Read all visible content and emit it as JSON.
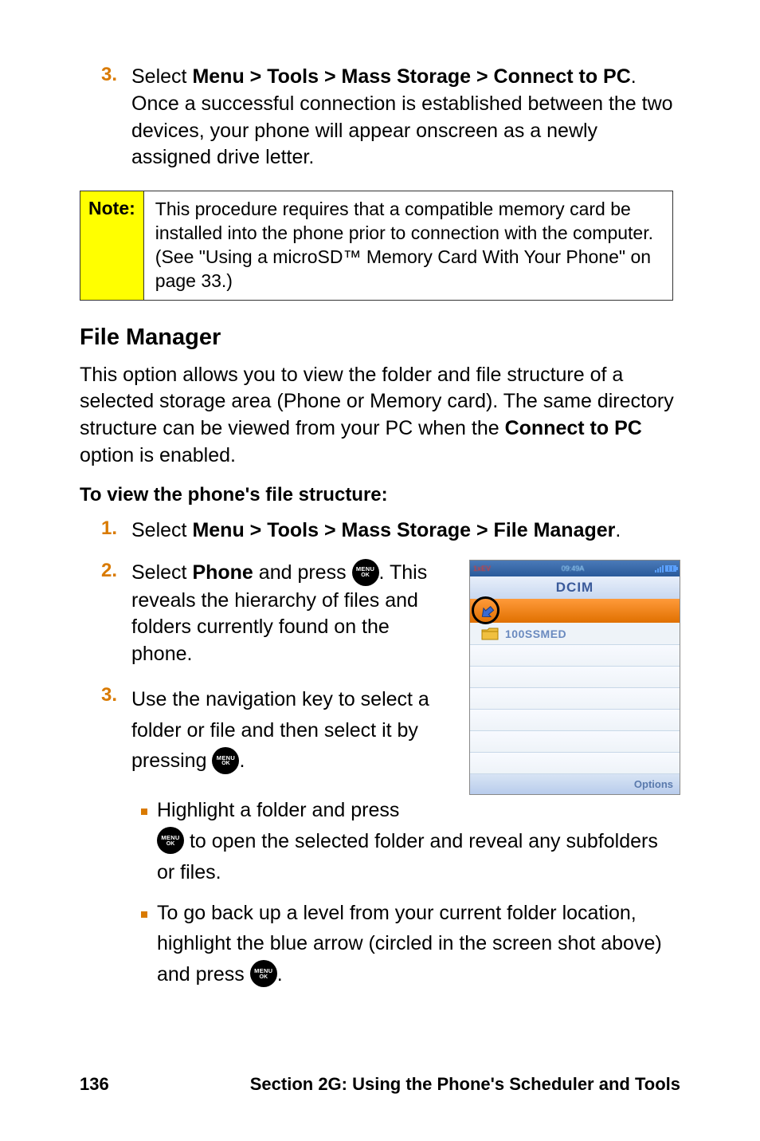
{
  "step3top": {
    "num": "3.",
    "lead": "Select ",
    "path": "Menu > Tools > Mass Storage > Connect to PC",
    "tail": ". Once a successful connection is established between the two devices, your phone will appear onscreen as a newly assigned drive letter."
  },
  "note": {
    "label": "Note:",
    "text": "This procedure requires that a compatible memory card be installed into the phone prior to connection with the computer. (See \"Using a microSD™ Memory Card With Your Phone\" on page 33.)"
  },
  "h2": "File Manager",
  "para": {
    "pre": "This option allows you to view the folder and file structure of a selected storage area (Phone or Memory card). The same directory structure can be viewed from your PC when the ",
    "bold": "Connect to PC",
    "post": " option is enabled."
  },
  "subhead": "To view the phone's file structure:",
  "step1": {
    "num": "1.",
    "lead": "Select ",
    "path": "Menu > Tools > Mass Storage > File Manager",
    "tail": "."
  },
  "step2": {
    "num": "2.",
    "lead": "Select ",
    "bold": "Phone",
    "mid": " and press ",
    "tail": ". This reveals the hierarchy of files and folders currently found on the phone."
  },
  "step3b": {
    "num": "3.",
    "pre": "Use the navigation key to select a folder or file and then select it by pressing ",
    "post": "."
  },
  "bullets": {
    "b1": {
      "pre": "Highlight a folder and press ",
      "post": " to open the selected folder and reveal any subfolders or files."
    },
    "b2": {
      "pre": "To go back up a level from your current folder location, highlight the blue arrow (circled in the screen shot above) and press ",
      "post": "."
    }
  },
  "menuIcon": {
    "line1": "MENU",
    "line2": "OK"
  },
  "screenshot": {
    "statusLeft": "1xEV",
    "statusMid": "09:49A",
    "title": "DCIM",
    "folder": "100SSMED",
    "softkey": "Options"
  },
  "footer": {
    "page": "136",
    "section": "Section 2G: Using the Phone's Scheduler and Tools"
  }
}
